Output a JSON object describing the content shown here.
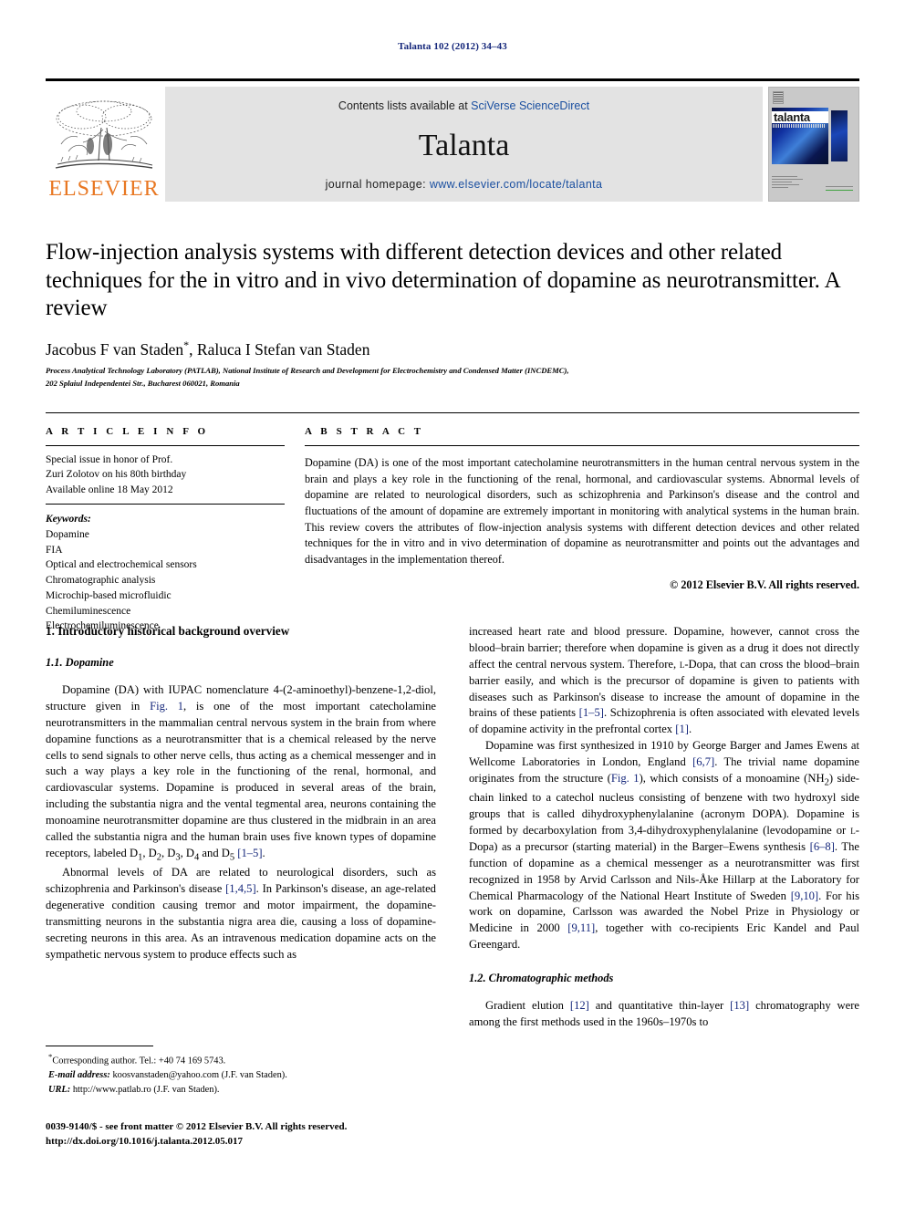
{
  "running_head": "Talanta 102 (2012) 34–43",
  "journal_header": {
    "publisher_name": "ELSEVIER",
    "contents_prefix": "Contents lists available at ",
    "contents_link": "SciVerse ScienceDirect",
    "journal_title": "Talanta",
    "homepage_prefix": "journal homepage: ",
    "homepage_url": "www.elsevier.com/locate/talanta",
    "cover_wordmark": "talanta"
  },
  "article": {
    "title": "Flow-injection analysis systems with different detection devices and other related techniques for the in vitro and in vivo determination of dopamine as neurotransmitter. A review",
    "authors": "Jacobus F van Staden",
    "authors_marker": "*",
    "authors_rest": ", Raluca I Stefan van Staden",
    "affiliation_line1": "Process Analytical Technology Laboratory (PATLAB), National Institute of Research and Development for Electrochemistry and Condensed Matter (INCDEMC),",
    "affiliation_line2": "202 Splaiul Independentei Str., Bucharest 060021, Romania"
  },
  "article_info": {
    "heading": "A R T I C L E   I N F O",
    "history": [
      "Special issue in honor of Prof.",
      "Zuri Zolotov on his 80th birthday",
      "Available online 18 May 2012"
    ],
    "keywords_title": "Keywords:",
    "keywords": [
      "Dopamine",
      "FIA",
      "Optical and electrochemical sensors",
      "Chromatographic analysis",
      "Microchip-based microfluidic",
      "Chemiluminescence",
      "Electrochemiluminescence"
    ]
  },
  "abstract": {
    "heading": "A B S T R A C T",
    "text": "Dopamine (DA) is one of the most important catecholamine neurotransmitters in the human central nervous system in the brain and plays a key role in the functioning of the renal, hormonal, and cardiovascular systems. Abnormal levels of dopamine are related to neurological disorders, such as schizophrenia and Parkinson's disease and the control and fluctuations of the amount of dopamine are extremely important in monitoring with analytical systems in the human brain. This review covers the attributes of flow-injection analysis systems with different detection devices and other related techniques for the in vitro and in vivo determination of dopamine as neurotransmitter and points out the advantages and disadvantages in the implementation thereof.",
    "copyright": "© 2012 Elsevier B.V. All rights reserved."
  },
  "body": {
    "section1_heading": "1.  Introductory historical background overview",
    "section1_1_heading": "1.1.  Dopamine",
    "left_p1_a": "Dopamine (DA) with IUPAC nomenclature 4-(2-aminoethyl)-benzene-1,2-diol, structure given in ",
    "left_p1_ref": "Fig. 1",
    "left_p1_b": ", is one of the most important catecholamine neurotransmitters in the mammalian central nervous system in the brain from where dopamine functions as a neurotransmitter that is a chemical released by the nerve cells to send signals to other nerve cells, thus acting as a chemical messenger and in such a way plays a key role in the functioning of the renal, hormonal, and cardiovascular systems. Dopamine is produced in several areas of the brain, including the substantia nigra and the vental tegmental area, neurons containing the monoamine neurotransmitter dopamine are thus clustered in the midbrain in an area called the substantia nigra and the human brain uses five known types of dopamine receptors, labeled D",
    "left_p1_sub1": "1",
    "left_p1_c": ", D",
    "left_p1_sub2": "2",
    "left_p1_d": ", D",
    "left_p1_sub3": "3",
    "left_p1_e": ", D",
    "left_p1_sub4": "4",
    "left_p1_f": " and D",
    "left_p1_sub5": "5",
    "left_p1_g": " ",
    "left_p1_ref2": "[1–5]",
    "left_p1_h": ".",
    "left_p2_a": "Abnormal levels of DA are related to neurological disorders, such as schizophrenia and Parkinson's disease ",
    "left_p2_ref": "[1,4,5]",
    "left_p2_b": ". In Parkinson's disease, an age-related degenerative condition causing tremor and motor impairment, the dopamine-transmitting neurons in the substantia nigra area die, causing a loss of dopamine-secreting neurons in this area. As an intravenous medication dopamine acts on the sympathetic nervous system to produce effects such as",
    "right_p1_a": "increased heart rate and blood pressure. Dopamine, however, cannot cross the blood–brain barrier; therefore when dopamine is given as a drug it does not directly affect the central nervous system. Therefore, ",
    "right_p1_sc": "l",
    "right_p1_b": "-Dopa, that can cross the blood–brain barrier easily, and which is the precursor of dopamine is given to patients with diseases such as Parkinson's disease to increase the amount of dopamine in the brains of these patients ",
    "right_p1_ref": "[1–5]",
    "right_p1_c": ". Schizophrenia is often associated with elevated levels of dopamine activity in the prefrontal cortex ",
    "right_p1_ref2": "[1]",
    "right_p1_d": ".",
    "right_p2_a": "Dopamine was first synthesized in 1910 by George Barger and James Ewens at Wellcome Laboratories in London, England ",
    "right_p2_ref": "[6,7]",
    "right_p2_b": ". The trivial name dopamine originates from the structure (",
    "right_p2_ref2": "Fig. 1",
    "right_p2_c": "), which consists of a monoamine (NH",
    "right_p2_sub": "2",
    "right_p2_d": ") side-chain linked to a catechol nucleus consisting of benzene with two hydroxyl side groups that is called dihydroxyphenylalanine (acronym DOPA). Dopamine is formed by decarboxylation from 3,4-dihydroxyphenylalanine (levodopamine or ",
    "right_p2_sc": "l",
    "right_p2_e": "-Dopa) as a precursor (starting material) in the Barger–Ewens synthesis ",
    "right_p2_ref3": "[6–8]",
    "right_p2_f": ". The function of dopamine as a chemical messenger as a neurotransmitter was first recognized in 1958 by Arvid Carlsson and Nils-Åke Hillarp at the Laboratory for Chemical Pharmacology of the National Heart Institute of Sweden ",
    "right_p2_ref4": "[9,10]",
    "right_p2_g": ". For his work on dopamine, Carlsson was awarded the Nobel Prize in Physiology or Medicine in 2000 ",
    "right_p2_ref5": "[9,11]",
    "right_p2_h": ", together with co-recipients Eric Kandel and Paul Greengard.",
    "section1_2_heading": "1.2.  Chromatographic methods",
    "right_p3_a": "Gradient elution ",
    "right_p3_ref": "[12]",
    "right_p3_b": " and quantitative thin-layer ",
    "right_p3_ref2": "[13]",
    "right_p3_c": " chromatography were among the first methods used in the 1960s–1970s to"
  },
  "footnotes": {
    "corresponding": "Corresponding author. Tel.: +40 74 169 5743.",
    "email_label": "E-mail address:",
    "email_value": " koosvanstaden@yahoo.com (J.F. van Staden).",
    "url_label": "URL:",
    "url_value": " http://www.patlab.ro (J.F. van Staden)."
  },
  "imprint": {
    "line1": "0039-9140/$ - see front matter © 2012 Elsevier B.V. All rights reserved.",
    "line2": "http://dx.doi.org/10.1016/j.talanta.2012.05.017"
  }
}
